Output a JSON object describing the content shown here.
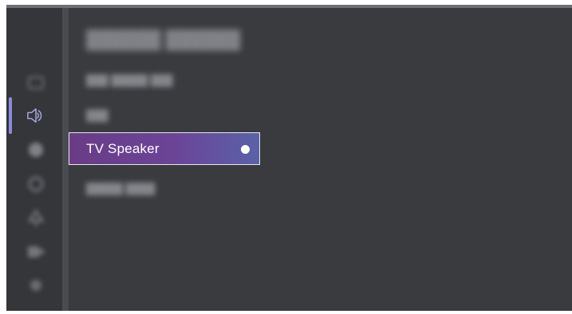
{
  "colors": {
    "background": "#3a3b3f",
    "rail": "#35363a",
    "accent": "#8d8ad8",
    "selected_gradient_start": "#6a3c86",
    "selected_gradient_end": "#5a62a8"
  },
  "sidebar": {
    "items": [
      {
        "icon": "picture-icon",
        "active": false
      },
      {
        "icon": "sound-icon",
        "active": true
      },
      {
        "icon": "network-icon",
        "active": false
      },
      {
        "icon": "system-icon",
        "active": false
      },
      {
        "icon": "accessibility-icon",
        "active": false
      },
      {
        "icon": "input-icon",
        "active": false
      },
      {
        "icon": "support-icon",
        "active": false
      }
    ]
  },
  "menu": {
    "options": [
      {
        "selected": true,
        "label": "TV Speaker"
      }
    ]
  }
}
